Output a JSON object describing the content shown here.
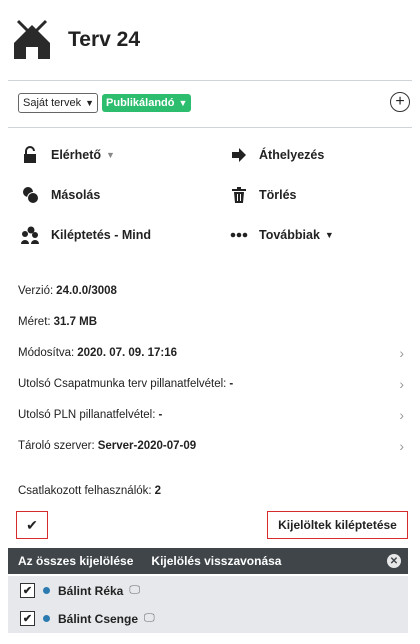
{
  "header": {
    "title": "Terv 24",
    "logo_icon": "house-icon"
  },
  "filters": {
    "project_select": "Saját tervek",
    "status_select": "Publikálandó",
    "status_color": "#2dbd6e"
  },
  "actions": {
    "available": "Elérhető",
    "move": "Áthelyezés",
    "copy": "Másolás",
    "delete": "Törlés",
    "kickout_all": "Kiléptetés - Mind",
    "more": "Továbbiak"
  },
  "info": {
    "version": {
      "label": "Verzió:",
      "value": "24.0.0/3008"
    },
    "size": {
      "label": "Méret:",
      "value": "31.7 MB"
    },
    "modified": {
      "label": "Módosítva:",
      "value": "2020. 07. 09. 17:16"
    },
    "last_teamwork_snapshot": {
      "label": "Utolsó Csapatmunka terv pillanatfelvétel:",
      "value": "-"
    },
    "last_pln_snapshot": {
      "label": "Utolsó PLN pillanatfelvétel:",
      "value": "-"
    },
    "storage_server": {
      "label": "Tároló szerver:",
      "value": "Server-2020-07-09"
    },
    "connected_users": {
      "label": "Csatlakozott felhasználók:",
      "value": "2"
    }
  },
  "selection": {
    "select_all": "Az összes kijelölése",
    "deselect": "Kijelölés visszavonása",
    "kickout_selected": "Kijelöltek kiléptetése",
    "highlight_color": "#d92b2b"
  },
  "users": [
    {
      "name": "Bálint Réka",
      "checked": true
    },
    {
      "name": "Bálint Csenge",
      "checked": true
    }
  ]
}
